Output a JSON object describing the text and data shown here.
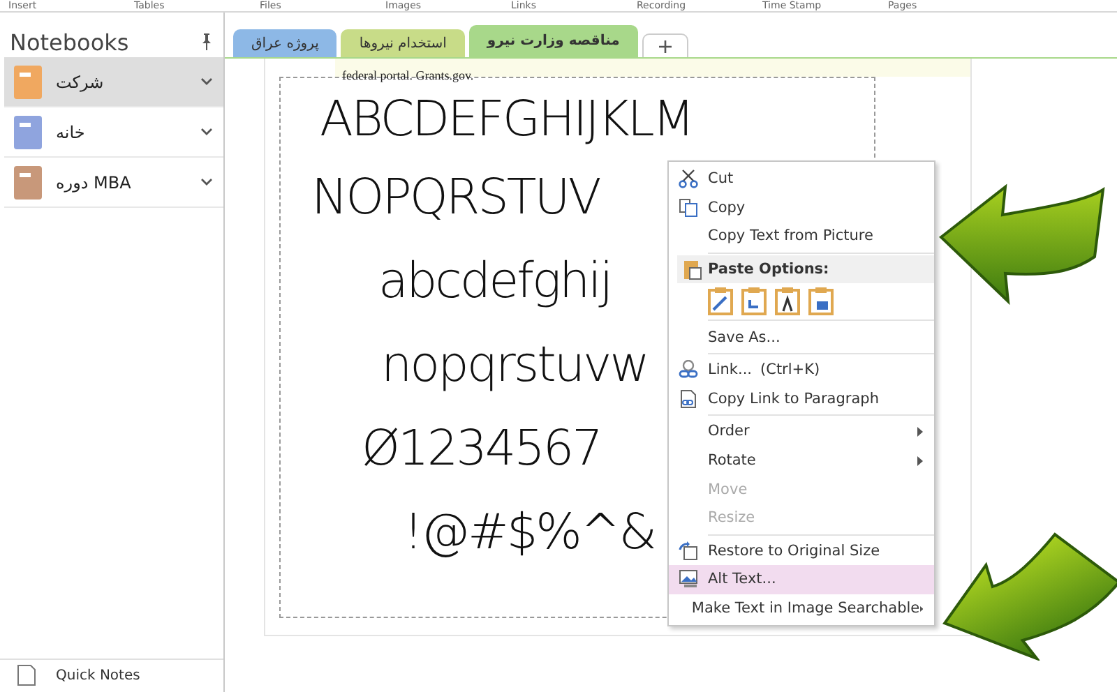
{
  "ribbon_groups": [
    "Insert",
    "Tables",
    "Files",
    "Images",
    "Links",
    "Recording",
    "Time Stamp",
    "Pages"
  ],
  "sidebar": {
    "title": "Notebooks",
    "items": [
      {
        "label": "شرکت",
        "color": "#f0a860",
        "selected": true
      },
      {
        "label": "خانه",
        "color": "#8fa4de",
        "selected": false
      },
      {
        "label": "دوره MBA",
        "color": "#c8987a",
        "selected": false
      }
    ],
    "footer": "Quick Notes"
  },
  "tabs": [
    {
      "label": "مناقصه وزارت نیرو",
      "color": "#a8d88a",
      "selected": true
    },
    {
      "label": "استخدام نیروها",
      "color": "#c8dc88",
      "selected": false
    },
    {
      "label": "پروژه عراق",
      "color": "#8db8e6",
      "selected": false
    }
  ],
  "page": {
    "note": "federal portal. Grants.gov.",
    "image_lines": [
      "ABCDEFGHIJKLM",
      "NOPQRSTUV",
      "abcdefghij",
      "nopqrstuvw",
      "Ø1234567",
      "!@#$%^&"
    ]
  },
  "context_menu": [
    {
      "kind": "item",
      "label": "Cut",
      "disabled": false,
      "submenu": false,
      "selected": false
    },
    {
      "kind": "item",
      "label": "Copy",
      "disabled": false,
      "submenu": false,
      "selected": false
    },
    {
      "kind": "item",
      "label": "Copy Text from Picture",
      "disabled": false,
      "submenu": false,
      "selected": false
    },
    {
      "kind": "header",
      "label": "Paste Options:"
    },
    {
      "kind": "paste"
    },
    {
      "kind": "item",
      "label": "Save As...",
      "disabled": false,
      "submenu": false,
      "selected": false
    },
    {
      "kind": "item",
      "label": "Link...",
      "shortcut": "(Ctrl+K)",
      "disabled": false,
      "submenu": false,
      "selected": false
    },
    {
      "kind": "item",
      "label": "Copy Link to Paragraph",
      "disabled": false,
      "submenu": false,
      "selected": false
    },
    {
      "kind": "item",
      "label": "Order",
      "disabled": false,
      "submenu": true,
      "selected": false
    },
    {
      "kind": "item",
      "label": "Rotate",
      "disabled": false,
      "submenu": true,
      "selected": false
    },
    {
      "kind": "item",
      "label": "Move",
      "disabled": true,
      "submenu": false,
      "selected": false
    },
    {
      "kind": "item",
      "label": "Resize",
      "disabled": true,
      "submenu": false,
      "selected": false
    },
    {
      "kind": "item",
      "label": "Restore to Original Size",
      "disabled": false,
      "submenu": false,
      "selected": false
    },
    {
      "kind": "item",
      "label": "Alt Text...",
      "disabled": false,
      "submenu": false,
      "selected": true
    },
    {
      "kind": "item",
      "label": "Make Text in Image Searchable",
      "disabled": false,
      "submenu": true,
      "selected": false
    }
  ]
}
